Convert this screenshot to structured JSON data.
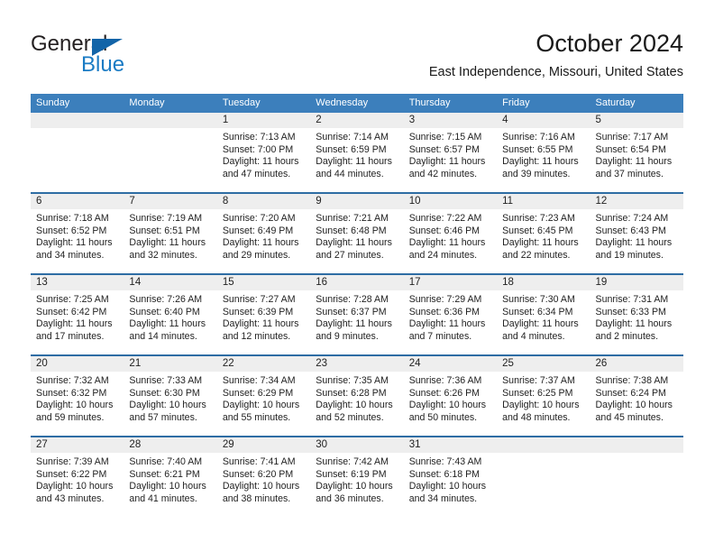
{
  "brand": {
    "name_top": "General",
    "name_bottom": "Blue",
    "accent_color": "#1a7bc4",
    "triangle_color": "#1264a8"
  },
  "header": {
    "title": "October 2024",
    "subtitle": "East Independence, Missouri, United States"
  },
  "theme": {
    "header_bg": "#3c7fbc",
    "week_divider": "#2e6da4",
    "daynum_bg": "#eeeeee",
    "text": "#222222"
  },
  "weekdays": [
    "Sunday",
    "Monday",
    "Tuesday",
    "Wednesday",
    "Thursday",
    "Friday",
    "Saturday"
  ],
  "weeks": [
    [
      {
        "day": "",
        "sunrise": "",
        "sunset": "",
        "daylight1": "",
        "daylight2": ""
      },
      {
        "day": "",
        "sunrise": "",
        "sunset": "",
        "daylight1": "",
        "daylight2": ""
      },
      {
        "day": "1",
        "sunrise": "Sunrise: 7:13 AM",
        "sunset": "Sunset: 7:00 PM",
        "daylight1": "Daylight: 11 hours",
        "daylight2": "and 47 minutes."
      },
      {
        "day": "2",
        "sunrise": "Sunrise: 7:14 AM",
        "sunset": "Sunset: 6:59 PM",
        "daylight1": "Daylight: 11 hours",
        "daylight2": "and 44 minutes."
      },
      {
        "day": "3",
        "sunrise": "Sunrise: 7:15 AM",
        "sunset": "Sunset: 6:57 PM",
        "daylight1": "Daylight: 11 hours",
        "daylight2": "and 42 minutes."
      },
      {
        "day": "4",
        "sunrise": "Sunrise: 7:16 AM",
        "sunset": "Sunset: 6:55 PM",
        "daylight1": "Daylight: 11 hours",
        "daylight2": "and 39 minutes."
      },
      {
        "day": "5",
        "sunrise": "Sunrise: 7:17 AM",
        "sunset": "Sunset: 6:54 PM",
        "daylight1": "Daylight: 11 hours",
        "daylight2": "and 37 minutes."
      }
    ],
    [
      {
        "day": "6",
        "sunrise": "Sunrise: 7:18 AM",
        "sunset": "Sunset: 6:52 PM",
        "daylight1": "Daylight: 11 hours",
        "daylight2": "and 34 minutes."
      },
      {
        "day": "7",
        "sunrise": "Sunrise: 7:19 AM",
        "sunset": "Sunset: 6:51 PM",
        "daylight1": "Daylight: 11 hours",
        "daylight2": "and 32 minutes."
      },
      {
        "day": "8",
        "sunrise": "Sunrise: 7:20 AM",
        "sunset": "Sunset: 6:49 PM",
        "daylight1": "Daylight: 11 hours",
        "daylight2": "and 29 minutes."
      },
      {
        "day": "9",
        "sunrise": "Sunrise: 7:21 AM",
        "sunset": "Sunset: 6:48 PM",
        "daylight1": "Daylight: 11 hours",
        "daylight2": "and 27 minutes."
      },
      {
        "day": "10",
        "sunrise": "Sunrise: 7:22 AM",
        "sunset": "Sunset: 6:46 PM",
        "daylight1": "Daylight: 11 hours",
        "daylight2": "and 24 minutes."
      },
      {
        "day": "11",
        "sunrise": "Sunrise: 7:23 AM",
        "sunset": "Sunset: 6:45 PM",
        "daylight1": "Daylight: 11 hours",
        "daylight2": "and 22 minutes."
      },
      {
        "day": "12",
        "sunrise": "Sunrise: 7:24 AM",
        "sunset": "Sunset: 6:43 PM",
        "daylight1": "Daylight: 11 hours",
        "daylight2": "and 19 minutes."
      }
    ],
    [
      {
        "day": "13",
        "sunrise": "Sunrise: 7:25 AM",
        "sunset": "Sunset: 6:42 PM",
        "daylight1": "Daylight: 11 hours",
        "daylight2": "and 17 minutes."
      },
      {
        "day": "14",
        "sunrise": "Sunrise: 7:26 AM",
        "sunset": "Sunset: 6:40 PM",
        "daylight1": "Daylight: 11 hours",
        "daylight2": "and 14 minutes."
      },
      {
        "day": "15",
        "sunrise": "Sunrise: 7:27 AM",
        "sunset": "Sunset: 6:39 PM",
        "daylight1": "Daylight: 11 hours",
        "daylight2": "and 12 minutes."
      },
      {
        "day": "16",
        "sunrise": "Sunrise: 7:28 AM",
        "sunset": "Sunset: 6:37 PM",
        "daylight1": "Daylight: 11 hours",
        "daylight2": "and 9 minutes."
      },
      {
        "day": "17",
        "sunrise": "Sunrise: 7:29 AM",
        "sunset": "Sunset: 6:36 PM",
        "daylight1": "Daylight: 11 hours",
        "daylight2": "and 7 minutes."
      },
      {
        "day": "18",
        "sunrise": "Sunrise: 7:30 AM",
        "sunset": "Sunset: 6:34 PM",
        "daylight1": "Daylight: 11 hours",
        "daylight2": "and 4 minutes."
      },
      {
        "day": "19",
        "sunrise": "Sunrise: 7:31 AM",
        "sunset": "Sunset: 6:33 PM",
        "daylight1": "Daylight: 11 hours",
        "daylight2": "and 2 minutes."
      }
    ],
    [
      {
        "day": "20",
        "sunrise": "Sunrise: 7:32 AM",
        "sunset": "Sunset: 6:32 PM",
        "daylight1": "Daylight: 10 hours",
        "daylight2": "and 59 minutes."
      },
      {
        "day": "21",
        "sunrise": "Sunrise: 7:33 AM",
        "sunset": "Sunset: 6:30 PM",
        "daylight1": "Daylight: 10 hours",
        "daylight2": "and 57 minutes."
      },
      {
        "day": "22",
        "sunrise": "Sunrise: 7:34 AM",
        "sunset": "Sunset: 6:29 PM",
        "daylight1": "Daylight: 10 hours",
        "daylight2": "and 55 minutes."
      },
      {
        "day": "23",
        "sunrise": "Sunrise: 7:35 AM",
        "sunset": "Sunset: 6:28 PM",
        "daylight1": "Daylight: 10 hours",
        "daylight2": "and 52 minutes."
      },
      {
        "day": "24",
        "sunrise": "Sunrise: 7:36 AM",
        "sunset": "Sunset: 6:26 PM",
        "daylight1": "Daylight: 10 hours",
        "daylight2": "and 50 minutes."
      },
      {
        "day": "25",
        "sunrise": "Sunrise: 7:37 AM",
        "sunset": "Sunset: 6:25 PM",
        "daylight1": "Daylight: 10 hours",
        "daylight2": "and 48 minutes."
      },
      {
        "day": "26",
        "sunrise": "Sunrise: 7:38 AM",
        "sunset": "Sunset: 6:24 PM",
        "daylight1": "Daylight: 10 hours",
        "daylight2": "and 45 minutes."
      }
    ],
    [
      {
        "day": "27",
        "sunrise": "Sunrise: 7:39 AM",
        "sunset": "Sunset: 6:22 PM",
        "daylight1": "Daylight: 10 hours",
        "daylight2": "and 43 minutes."
      },
      {
        "day": "28",
        "sunrise": "Sunrise: 7:40 AM",
        "sunset": "Sunset: 6:21 PM",
        "daylight1": "Daylight: 10 hours",
        "daylight2": "and 41 minutes."
      },
      {
        "day": "29",
        "sunrise": "Sunrise: 7:41 AM",
        "sunset": "Sunset: 6:20 PM",
        "daylight1": "Daylight: 10 hours",
        "daylight2": "and 38 minutes."
      },
      {
        "day": "30",
        "sunrise": "Sunrise: 7:42 AM",
        "sunset": "Sunset: 6:19 PM",
        "daylight1": "Daylight: 10 hours",
        "daylight2": "and 36 minutes."
      },
      {
        "day": "31",
        "sunrise": "Sunrise: 7:43 AM",
        "sunset": "Sunset: 6:18 PM",
        "daylight1": "Daylight: 10 hours",
        "daylight2": "and 34 minutes."
      },
      {
        "day": "",
        "sunrise": "",
        "sunset": "",
        "daylight1": "",
        "daylight2": ""
      },
      {
        "day": "",
        "sunrise": "",
        "sunset": "",
        "daylight1": "",
        "daylight2": ""
      }
    ]
  ]
}
